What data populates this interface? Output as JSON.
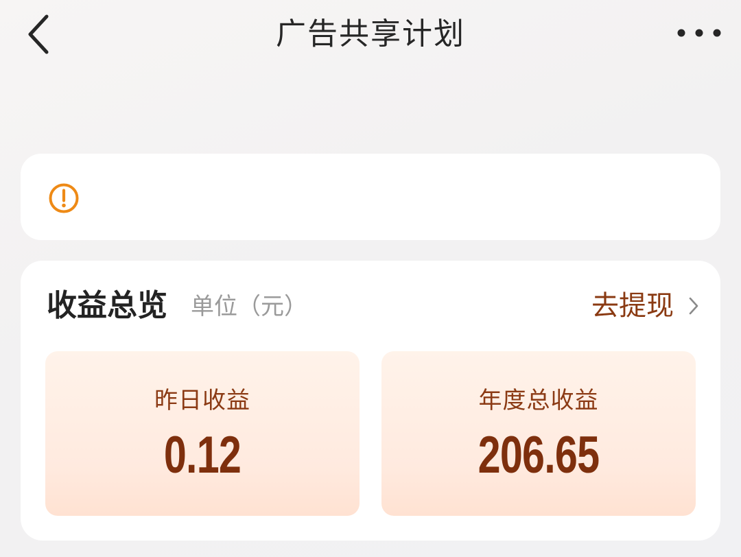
{
  "header": {
    "title": "广告共享计划",
    "back_icon": "chevron-left-icon",
    "more_icon": "more-horizontal-icon"
  },
  "notice": {
    "icon": "exclamation-circle-icon",
    "icon_color": "#ee8a16"
  },
  "overview": {
    "title": "收益总览",
    "unit": "单位（元）",
    "withdraw_label": "去提现",
    "withdraw_icon": "chevron-right-icon",
    "accent_color": "#8a3a12",
    "stats": [
      {
        "label": "昨日收益",
        "value": "0.12"
      },
      {
        "label": "年度总收益",
        "value": "206.65"
      }
    ]
  }
}
